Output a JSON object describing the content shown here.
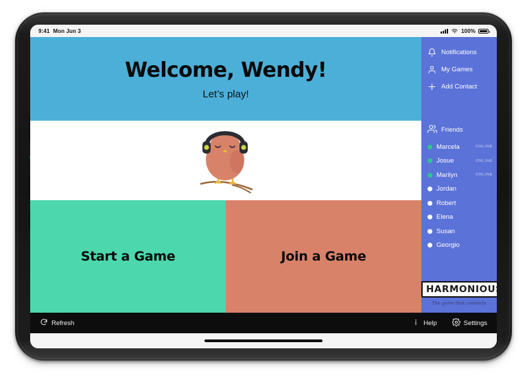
{
  "status_bar": {
    "time": "9:41",
    "date": "Mon Jun 3",
    "battery_percent": "100%",
    "signal_icon": "cellular-signal-icon",
    "wifi_icon": "wifi-icon",
    "battery_icon": "battery-icon"
  },
  "header": {
    "welcome": "Welcome, Wendy!",
    "subtitle": "Let’s play!"
  },
  "mascot": {
    "name": "bird-with-headphones-illustration",
    "body_color": "#D9826A",
    "headphone_color": "#2B2B33",
    "earcup_color": "#C9D94A",
    "beak_color": "#E8B93C",
    "branch_color": "#9C6B3F"
  },
  "actions": [
    {
      "label": "Start a Game",
      "name": "start-a-game-button",
      "color": "#4DD7AC"
    },
    {
      "label": "Join a Game",
      "name": "join-a-game-button",
      "color": "#D9826A"
    }
  ],
  "sidebar": {
    "background": "#5B72D8",
    "nav": [
      {
        "label": "Notifications",
        "icon": "bell-icon"
      },
      {
        "label": "My Games",
        "icon": "user-icon"
      },
      {
        "label": "Add Contact",
        "icon": "plus-icon"
      }
    ],
    "friends_header": {
      "label": "Friends",
      "icon": "group-icon"
    },
    "friends": [
      {
        "name": "Marcela",
        "status": "ONLINE",
        "online": true
      },
      {
        "name": "Josue",
        "status": "ONLINE",
        "online": true
      },
      {
        "name": "Marilyn",
        "status": "ONLINE",
        "online": true
      },
      {
        "name": "Jordan",
        "status": "",
        "online": false
      },
      {
        "name": "Robert",
        "status": "",
        "online": false
      },
      {
        "name": "Elena",
        "status": "",
        "online": false
      },
      {
        "name": "Susan",
        "status": "",
        "online": false
      },
      {
        "name": "Georgio",
        "status": "",
        "online": false
      }
    ],
    "online_color": "#27C98A",
    "offline_color": "#FFFFFF",
    "brand": {
      "name": "HARMONIOUS",
      "tagline": "The game that connects"
    }
  },
  "toolbar": {
    "refresh_label": "Refresh",
    "refresh_icon": "refresh-icon",
    "help_label": "Help",
    "help_icon": "info-icon",
    "settings_label": "Settings",
    "settings_icon": "gear-icon"
  }
}
